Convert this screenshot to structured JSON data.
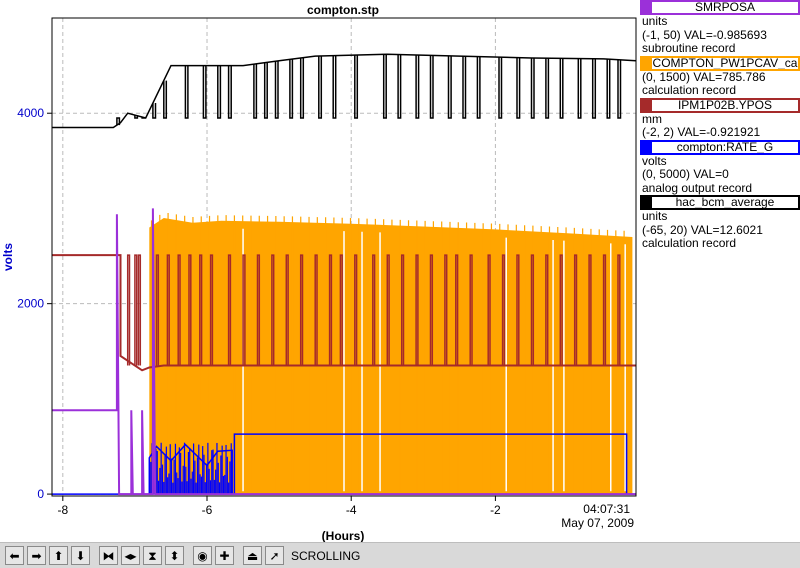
{
  "chart_data": {
    "type": "line",
    "title": "compton.stp",
    "xlabel": "(Hours)",
    "ylabel": "volts",
    "x_range": [
      -8.15,
      -0.05
    ],
    "y_range": [
      -20,
      5000
    ],
    "x_ticks": [
      -8,
      -6,
      -4,
      -2
    ],
    "y_ticks": [
      0,
      2000,
      4000
    ],
    "timestamp_time": "04:07:31",
    "timestamp_date": "May 07, 2009",
    "grid": true,
    "series": [
      {
        "name": "SMRPOSA",
        "color": "#9b30d9",
        "units": "units",
        "range": "(-1, 50)",
        "value": "VAL=-0.985693",
        "record": "subroutine record",
        "shape": "steps",
        "points": [
          [
            -8.15,
            880
          ],
          [
            -7.25,
            880
          ],
          [
            -7.25,
            2940
          ],
          [
            -7.22,
            0
          ],
          [
            -7.05,
            0
          ],
          [
            -7.05,
            880
          ],
          [
            -7.03,
            0
          ],
          [
            -6.9,
            0
          ],
          [
            -6.9,
            880
          ],
          [
            -6.88,
            0
          ],
          [
            -6.75,
            0
          ],
          [
            -6.75,
            3000
          ],
          [
            -6.72,
            0
          ],
          [
            -0.05,
            0
          ]
        ]
      },
      {
        "name": "COMPTON_PW1PCAV_ca",
        "color": "#ffa500",
        "units": "",
        "range": "(0, 1500)",
        "value": "VAL=785.786",
        "record": "calculation record",
        "shape": "band",
        "envelope_x": [
          -6.8,
          -6.6,
          -6.2,
          -5.8,
          -5,
          -4,
          -3,
          -2,
          -1,
          -0.1
        ],
        "envelope_top": [
          2800,
          2900,
          2850,
          2870,
          2860,
          2840,
          2810,
          2780,
          2740,
          2700
        ],
        "envelope_bottom": [
          0,
          0,
          0,
          0,
          0,
          0,
          0,
          0,
          0,
          0
        ],
        "gaps_x": [
          -5.5,
          -4.1,
          -3.85,
          -3.6,
          -1.85,
          -1.2,
          -1.05,
          -0.4,
          -0.2
        ]
      },
      {
        "name": "IPM1P02B.YPOS",
        "color": "#a52a2a",
        "units": "mm",
        "range": "(-2, 2)",
        "value": "VAL=-0.921921",
        "record": "",
        "shape": "steps",
        "base_value": 1350,
        "initial_value": 2510,
        "spike_value": 2510,
        "points": [
          [
            -8.15,
            2510
          ],
          [
            -7.2,
            2510
          ],
          [
            -7.2,
            1450
          ],
          [
            -6.9,
            1300
          ],
          [
            -6.8,
            1330
          ],
          [
            -6.6,
            1350
          ],
          [
            -0.05,
            1350
          ]
        ],
        "spikes_x": [
          -7.1,
          -7.0,
          -6.95,
          -6.7,
          -6.55,
          -6.4,
          -6.25,
          -6.1,
          -5.95,
          -5.7,
          -5.5,
          -5.3,
          -5.1,
          -4.9,
          -4.7,
          -4.5,
          -4.3,
          -4.15,
          -3.95,
          -3.7,
          -3.5,
          -3.3,
          -3.1,
          -2.9,
          -2.7,
          -2.55,
          -2.35,
          -2.1,
          -1.9,
          -1.7,
          -1.5,
          -1.3,
          -1.1,
          -0.9,
          -0.7,
          -0.5,
          -0.3
        ]
      },
      {
        "name": "compton:RATE_G",
        "color": "#0000ff",
        "units": "volts",
        "range": "(0, 5000)",
        "value": "VAL=0",
        "record": "analog output record",
        "shape": "burst-then-level",
        "points": [
          [
            -8.15,
            0
          ],
          [
            -6.8,
            0
          ],
          [
            -6.8,
            380
          ],
          [
            -6.7,
            500
          ],
          [
            -6.5,
            350
          ],
          [
            -6.3,
            520
          ],
          [
            -6.0,
            300
          ],
          [
            -5.85,
            450
          ],
          [
            -5.65,
            460
          ],
          [
            -5.65,
            0
          ],
          [
            -5.62,
            0
          ],
          [
            -5.62,
            630
          ],
          [
            -0.18,
            630
          ],
          [
            -0.18,
            0
          ],
          [
            -0.05,
            0
          ]
        ]
      },
      {
        "name": "hac_bcm_average",
        "color": "#000000",
        "units": "units",
        "range": "(-65, 20)",
        "value": "VAL=12.6021",
        "record": "calculation record",
        "shape": "telegraph",
        "base_value": 3850,
        "high_value": 4450,
        "low_value": 3950,
        "points": [
          [
            -8.15,
            3850
          ],
          [
            -7.3,
            3850
          ],
          [
            -7.2,
            3900
          ],
          [
            -7.1,
            4000
          ],
          [
            -6.85,
            3950
          ],
          [
            -6.5,
            4500
          ],
          [
            -5.5,
            4500
          ],
          [
            -5.0,
            4550
          ],
          [
            -4.5,
            4600
          ],
          [
            -3.5,
            4620
          ],
          [
            -2.5,
            4600
          ],
          [
            -1.5,
            4580
          ],
          [
            -0.5,
            4570
          ],
          [
            -0.05,
            4550
          ]
        ],
        "drops_x": [
          -7.25,
          -7.0,
          -6.9,
          -6.75,
          -6.6,
          -6.3,
          -6.05,
          -5.85,
          -5.7,
          -5.35,
          -5.2,
          -5.05,
          -4.85,
          -4.7,
          -4.45,
          -4.25,
          -3.95,
          -3.55,
          -3.35,
          -3.1,
          -2.9,
          -2.65,
          -2.45,
          -2.25,
          -1.95,
          -1.7,
          -1.5,
          -1.3,
          -1.1,
          -0.85,
          -0.65,
          -0.45,
          -0.3
        ]
      }
    ]
  },
  "toolbar": {
    "status": "SCROLLING",
    "buttons": [
      {
        "name": "pan-left-button",
        "glyph": "⬅"
      },
      {
        "name": "pan-right-button",
        "glyph": "➡"
      },
      {
        "name": "pan-up-button",
        "glyph": "⬆"
      },
      {
        "name": "pan-down-button",
        "glyph": "⬇"
      },
      {
        "name": "zoom-in-horizontal-button",
        "glyph": "⧓"
      },
      {
        "name": "zoom-out-horizontal-button",
        "glyph": "◂▸"
      },
      {
        "name": "zoom-in-vertical-button",
        "glyph": "⧗"
      },
      {
        "name": "zoom-out-vertical-button",
        "glyph": "⬍"
      },
      {
        "name": "auto-scale-button",
        "glyph": "◉"
      },
      {
        "name": "reset-button",
        "glyph": "✚"
      },
      {
        "name": "scroll-mode-button",
        "glyph": "⏏"
      },
      {
        "name": "pointer-mode-button",
        "glyph": "➚"
      }
    ]
  }
}
